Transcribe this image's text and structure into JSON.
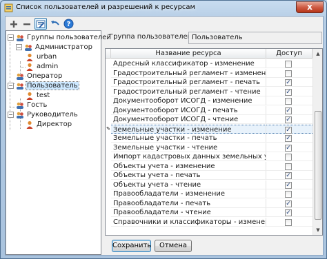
{
  "window": {
    "title": "Список пользователей и разрешений к ресурсам",
    "close_symbol": "x"
  },
  "toolbar": {
    "buttons": [
      {
        "name": "add-icon",
        "glyph": "+"
      },
      {
        "name": "remove-icon",
        "glyph": "−"
      },
      {
        "name": "edit-icon",
        "glyph": ""
      },
      {
        "name": "undo-icon",
        "glyph": "↶"
      },
      {
        "name": "help-icon",
        "glyph": "?"
      }
    ]
  },
  "tree": {
    "root": "Группы пользователей",
    "nodes": [
      {
        "label": "Администратор"
      },
      {
        "label": "urban"
      },
      {
        "label": "admin"
      },
      {
        "label": "Оператор"
      },
      {
        "label": "Пользователь"
      },
      {
        "label": "test"
      },
      {
        "label": "Гость"
      },
      {
        "label": "Руководитель"
      },
      {
        "label": "Директор"
      }
    ]
  },
  "group": {
    "label": "Группа пользователей",
    "value": "Пользователь"
  },
  "grid": {
    "columns": [
      "Название ресурса",
      "Доступ"
    ],
    "rows": [
      {
        "name": "Адресный классификатор - изменение",
        "access": false
      },
      {
        "name": "Градостроительный регламент - изменение",
        "access": false
      },
      {
        "name": "Градостроительный регламент - печать",
        "access": true
      },
      {
        "name": "Градостроительный регламент - чтение",
        "access": true
      },
      {
        "name": "Документооборот ИСОГД - изменение",
        "access": false
      },
      {
        "name": "Документооборот ИСОГД - печать",
        "access": true
      },
      {
        "name": "Документооборот ИСОГД - чтение",
        "access": true
      },
      {
        "name": "Земельные участки - изменение",
        "access": true,
        "current": true
      },
      {
        "name": "Земельные участки - печать",
        "access": true
      },
      {
        "name": "Земельные участки - чтение",
        "access": true
      },
      {
        "name": "Импорт кадастровых данных земельных участков из",
        "access": false
      },
      {
        "name": "Объекты учета - изменение",
        "access": false
      },
      {
        "name": "Объекты учета - печать",
        "access": true
      },
      {
        "name": "Объекты учета - чтение",
        "access": true
      },
      {
        "name": "Правообладатели - изменение",
        "access": false
      },
      {
        "name": "Правообладатели - печать",
        "access": true
      },
      {
        "name": "Правообладатели - чтение",
        "access": true
      },
      {
        "name": "Справочники и классификаторы - изменение",
        "access": false
      }
    ]
  },
  "buttons": {
    "save": "Сохранить",
    "cancel": "Отмена"
  }
}
